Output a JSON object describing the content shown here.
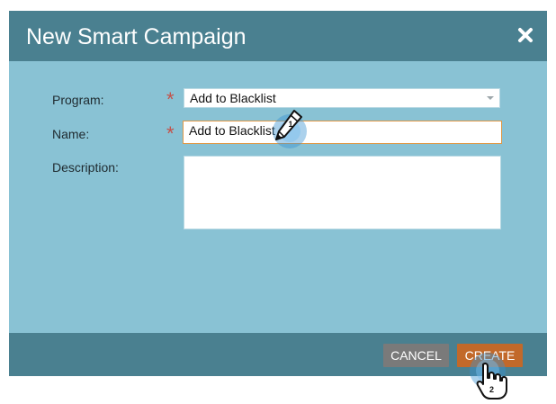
{
  "dialog": {
    "title": "New Smart Campaign"
  },
  "form": {
    "program": {
      "label": "Program:",
      "value": "Add to Blacklist",
      "required_marker": "*"
    },
    "name": {
      "label": "Name:",
      "value": "Add to Blacklist",
      "required_marker": "*"
    },
    "description": {
      "label": "Description:",
      "value": ""
    }
  },
  "buttons": {
    "cancel": "CANCEL",
    "create": "CREATE"
  },
  "annotations": {
    "step1": "1",
    "step2": "2"
  },
  "icons": {
    "close": "close-icon",
    "dropdown": "chevron-down-icon",
    "pencil": "pencil-icon",
    "hand": "hand-pointer-icon"
  },
  "colors": {
    "header": "#4a8090",
    "dialog_body": "#89c2d4",
    "required": "#c4524a",
    "focus_border": "#e09846",
    "cancel_button": "#7a7a7a",
    "create_button": "#c2692a"
  }
}
